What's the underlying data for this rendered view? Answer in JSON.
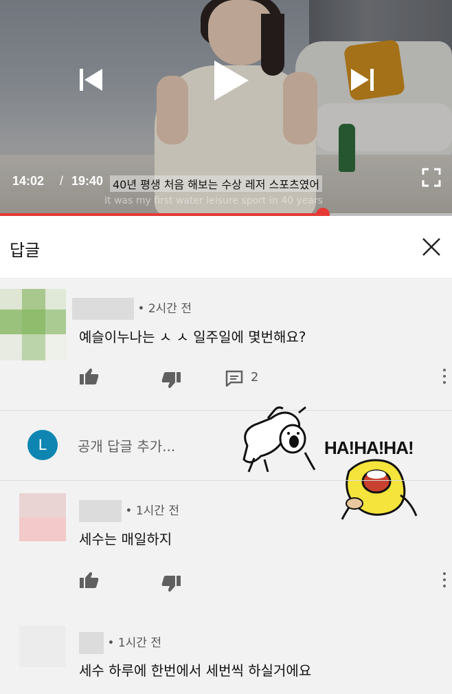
{
  "video": {
    "time_current": "14:02",
    "time_separator": "/",
    "time_total": "19:40",
    "subtitle_ko": "40년 평생 처음 해보는 수상 레저 스포츠였어",
    "subtitle_en": "It was my first water leisure sport in 40 years",
    "progress_fraction": 0.7136,
    "accent_color": "#e53935",
    "icons": [
      "previous-icon",
      "play-icon",
      "next-icon",
      "fullscreen-icon"
    ]
  },
  "panel": {
    "title": "답글",
    "close_icon": "close-icon"
  },
  "comments": [
    {
      "time": "• 2시간 전",
      "text": "예슬이누나는 ㅅ ㅅ  일주일에 몇번해요?",
      "reply_count": "2"
    },
    {
      "time": "• 1시간 전",
      "text": "세수는 매일하지"
    },
    {
      "time": "• 1시간 전",
      "text": "세수 하루에 한번에서 세번씩 하실거에요"
    }
  ],
  "add_reply": {
    "avatar_letter": "L",
    "avatar_color": "#0f86b2",
    "placeholder": "공개 답글 추가..."
  },
  "sticker": {
    "text": "HA!HA!HA!"
  }
}
